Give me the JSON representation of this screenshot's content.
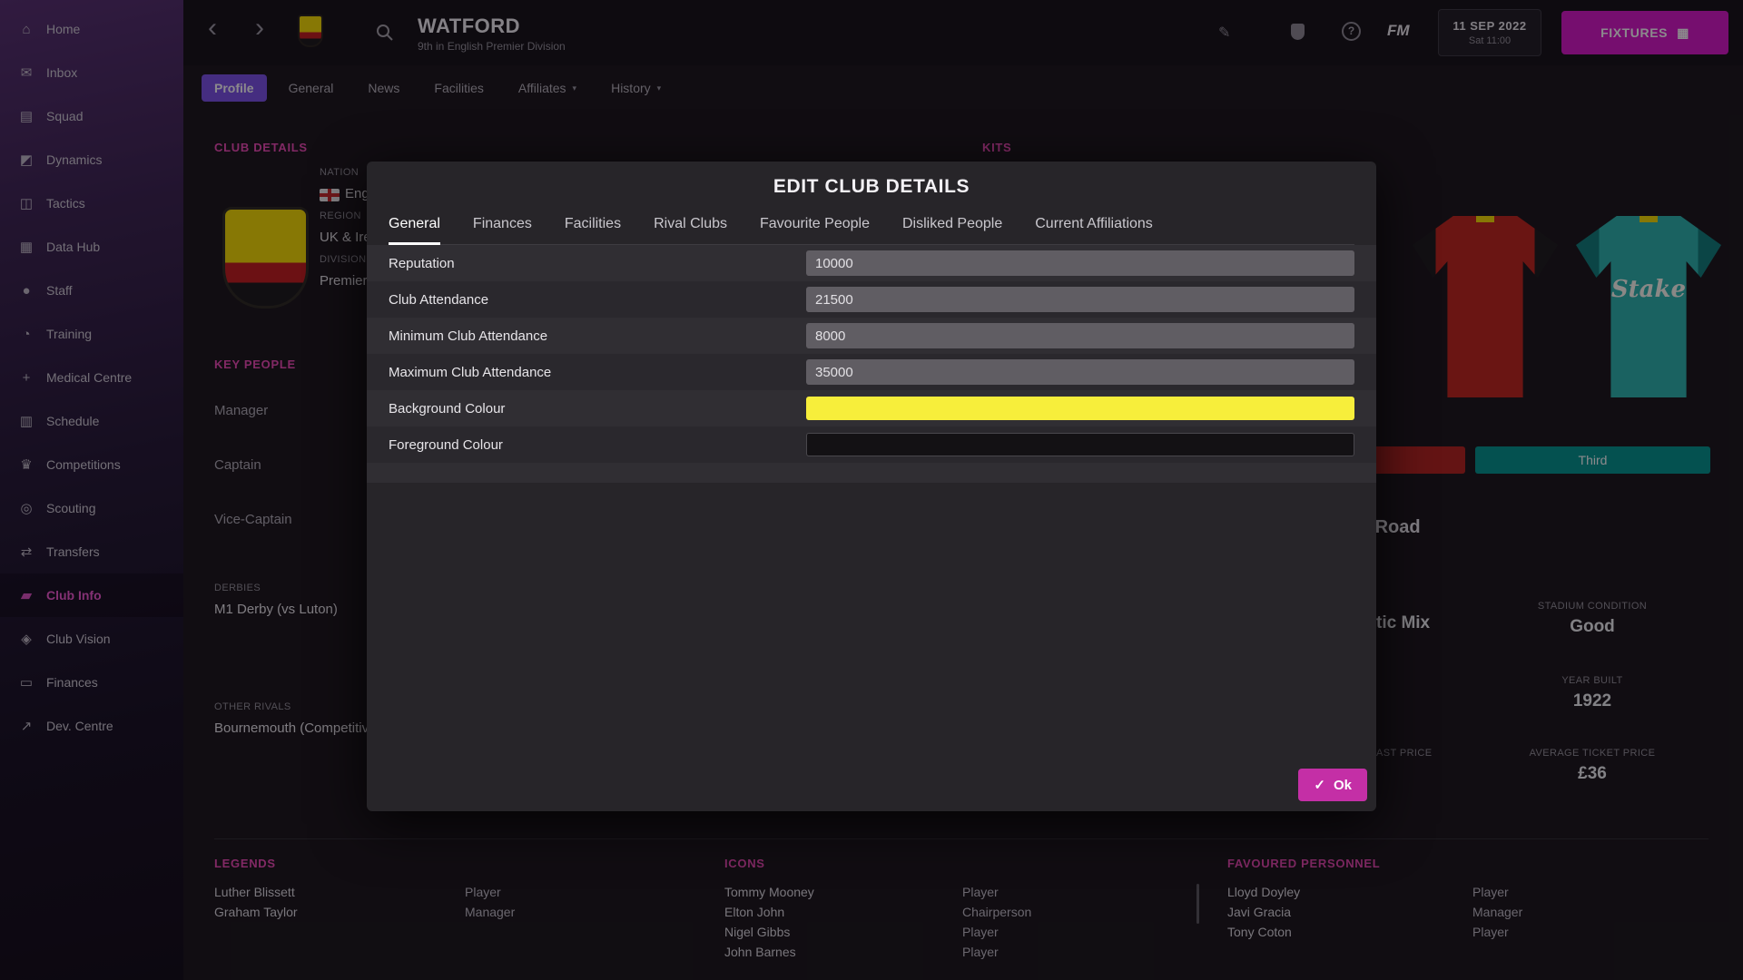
{
  "colors": {
    "accent_pink": "#ee4bb5",
    "sidebar_active_pink": "#f25ad2",
    "fixtures_button": "#d818c8",
    "active_tab_purple": "#7b52e8",
    "ok_button": "#c42fa6",
    "kit_home_red": "#b5231d",
    "kit_third_teal": "#00968e"
  },
  "sidebar": {
    "items": [
      {
        "label": "Home",
        "glyph": "⌂"
      },
      {
        "label": "Inbox",
        "glyph": "✉"
      },
      {
        "label": "Squad",
        "glyph": "▤"
      },
      {
        "label": "Dynamics",
        "glyph": "◩"
      },
      {
        "label": "Tactics",
        "glyph": "◫"
      },
      {
        "label": "Data Hub",
        "glyph": "▦"
      },
      {
        "label": "Staff",
        "glyph": "●"
      },
      {
        "label": "Training",
        "glyph": "◔"
      },
      {
        "label": "Medical Centre",
        "glyph": "+"
      },
      {
        "label": "Schedule",
        "glyph": "▥"
      },
      {
        "label": "Competitions",
        "glyph": "♛"
      },
      {
        "label": "Scouting",
        "glyph": "◎"
      },
      {
        "label": "Transfers",
        "glyph": "⇄"
      },
      {
        "label": "Club Info",
        "glyph": "▰",
        "active": true
      },
      {
        "label": "Club Vision",
        "glyph": "◈"
      },
      {
        "label": "Finances",
        "glyph": "▭"
      },
      {
        "label": "Dev. Centre",
        "glyph": "↗"
      }
    ]
  },
  "topbar": {
    "back_glyph": "‹",
    "forward_glyph": "›",
    "club_name": "WATFORD",
    "club_subtitle": "9th in English Premier Division",
    "edit_glyph": "✎",
    "help_glyph": "?",
    "fm_logo": "FM",
    "date": "11 SEP 2022",
    "time": "Sat 11:00",
    "fixtures_label": "FIXTURES",
    "fixtures_glyph": "▦"
  },
  "page_tabs": [
    {
      "label": "Profile",
      "active": true
    },
    {
      "label": "General"
    },
    {
      "label": "News"
    },
    {
      "label": "Facilities"
    },
    {
      "label": "Affiliates",
      "caret": "▾"
    },
    {
      "label": "History",
      "caret": "▾"
    }
  ],
  "club": {
    "section_title": "CLUB DETAILS",
    "fields": [
      {
        "label": "NATION",
        "value": "England"
      },
      {
        "label": "REGION",
        "value": "UK & Ireland"
      },
      {
        "label": "DIVISION",
        "value": "Premier Division"
      }
    ]
  },
  "key_people": {
    "section_title": "KEY PEOPLE",
    "roles": [
      "Manager",
      "Captain",
      "Vice-Captain"
    ]
  },
  "derbies": {
    "label": "DERBIES",
    "value": "M1 Derby (vs Luton)"
  },
  "other_rivals": {
    "label": "OTHER RIVALS",
    "value": "Bournemouth (Competitive)"
  },
  "kits": {
    "section_title": "KITS",
    "sponsor": "Stake",
    "third_label": "Third"
  },
  "stadium": {
    "name": "Vicarage Road",
    "left_value_fragment": "tic Mix",
    "left_label_fragment": "AST PRICE",
    "stats": [
      {
        "label": "STADIUM CONDITION",
        "value": "Good"
      },
      {
        "label": "YEAR BUILT",
        "value": "1922"
      },
      {
        "label": "AVERAGE TICKET PRICE",
        "value": "£36"
      }
    ]
  },
  "legends": {
    "section_title": "LEGENDS",
    "rows": [
      {
        "name": "Luther Blissett",
        "role": "Player"
      },
      {
        "name": "Graham Taylor",
        "role": "Manager"
      }
    ]
  },
  "club_icons": {
    "section_title": "ICONS",
    "rows": [
      {
        "name": "Tommy Mooney",
        "role": "Player"
      },
      {
        "name": "Elton John",
        "role": "Chairperson"
      },
      {
        "name": "Nigel Gibbs",
        "role": "Player"
      },
      {
        "name": "John Barnes",
        "role": "Player"
      }
    ]
  },
  "favoured": {
    "section_title": "FAVOURED PERSONNEL",
    "rows": [
      {
        "name": "Lloyd Doyley",
        "role": "Player"
      },
      {
        "name": "Javi Gracia",
        "role": "Manager"
      },
      {
        "name": "Tony Coton",
        "role": "Player"
      }
    ]
  },
  "modal": {
    "title": "EDIT CLUB DETAILS",
    "tabs": [
      {
        "label": "General",
        "active": true
      },
      {
        "label": "Finances"
      },
      {
        "label": "Facilities"
      },
      {
        "label": "Rival Clubs"
      },
      {
        "label": "Favourite People"
      },
      {
        "label": "Disliked People"
      },
      {
        "label": "Current Affiliations"
      }
    ],
    "fields": [
      {
        "label": "Reputation",
        "value": "10000",
        "type": "input"
      },
      {
        "label": "Club Attendance",
        "value": "21500",
        "type": "input"
      },
      {
        "label": "Minimum Club Attendance",
        "value": "8000",
        "type": "input"
      },
      {
        "label": "Maximum Club Attendance",
        "value": "35000",
        "type": "input"
      },
      {
        "label": "Background Colour",
        "value": "#f7ee3b",
        "type": "color"
      },
      {
        "label": "Foreground Colour",
        "value": "#131114",
        "type": "color"
      }
    ],
    "ok_label": "Ok",
    "ok_icon_glyph": "✓"
  }
}
